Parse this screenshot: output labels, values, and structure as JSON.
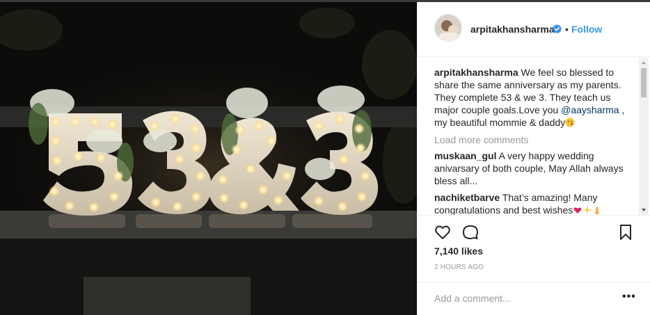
{
  "post": {
    "image_alt_icon": "marquee-letters-photo",
    "username": "arpitakhansharma",
    "separator": "•",
    "follow_label": "Follow",
    "likes": "7,140 likes",
    "time": "2 HOURS AGO",
    "add_comment_placeholder": "Add a comment...",
    "more_icon": "ellipsis-icon",
    "more_label": "•••"
  },
  "caption": {
    "username": "arpitakhansharma",
    "text_before": " We feel so blessed to share the same anniversary as my parents. They complete 53 & we 3. They teach us major couple goals.Love you ",
    "mention": "@aaysharma",
    "text_after": " , my beautiful mommie & daddy"
  },
  "load_more": "Load more comments",
  "comments": [
    {
      "username": "muskaan_gul",
      "text": " A very happy wedding anivarsary of both couple, May Allah always bless all..."
    },
    {
      "username": "nachiketbarve",
      "text": " That’s amazing! Many congratulations and best wishes"
    }
  ],
  "colors": {
    "follow": "#3897f0",
    "mention": "#003569",
    "muted": "#999999",
    "text": "#262626",
    "verified": "#3897f0"
  },
  "icons": [
    "heart-icon",
    "comment-icon",
    "bookmark-icon",
    "verified-badge-icon"
  ]
}
